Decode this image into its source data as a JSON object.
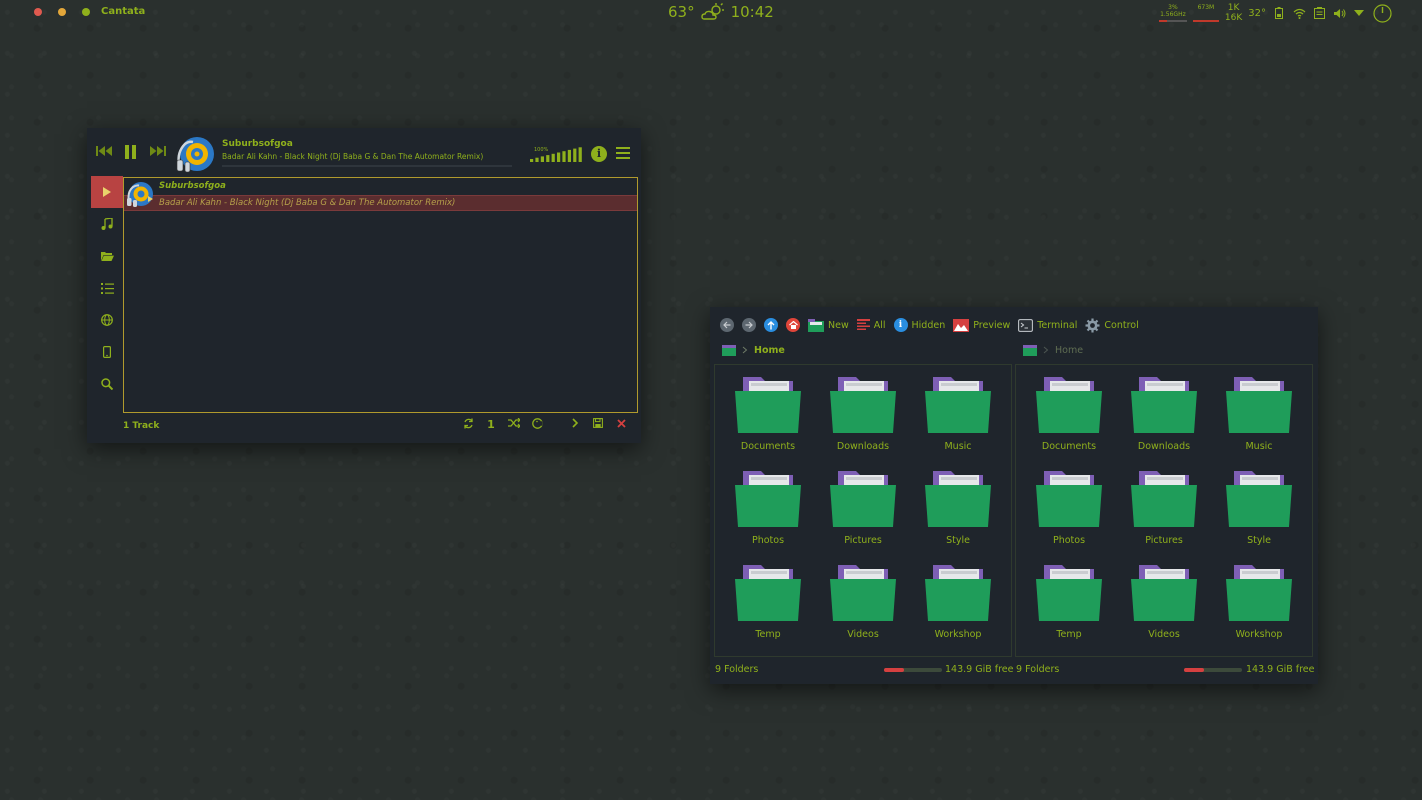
{
  "topbar": {
    "app_title": "Cantata",
    "temperature": "63°",
    "time": "10:42",
    "cpu_percent": "3%",
    "cpu_freq": "1.56GHz",
    "memory": "673M",
    "net_up": "1K",
    "net_down": "16K",
    "cpu_temp": "32°",
    "colors": {
      "close": "#e05a4f",
      "minimize": "#e3a73a",
      "maximize": "#8fb01c"
    }
  },
  "player": {
    "now_playing_artist": "Suburbsofgoa",
    "now_playing_title": "Badar Ali Kahn - Black Night (Dj Baba G & Dan The Automator Remix)",
    "volume_label": "100%",
    "volume": 1.0,
    "sidebar": [
      "play-queue-icon",
      "library-icon",
      "folders-icon",
      "playlists-icon",
      "internet-icon",
      "devices-icon",
      "search-icon"
    ],
    "playlist": {
      "artist": "Suburbsofgoa",
      "title": "Badar Ali Kahn - Black Night (Dj Baba G & Dan The Automator Remix)"
    },
    "status": "1 Track",
    "accent": "#8fb01c",
    "active_color": "#b84342"
  },
  "filemanager": {
    "toolbar": {
      "new": "New",
      "all": "All",
      "hidden": "Hidden",
      "preview": "Preview",
      "terminal": "Terminal",
      "control": "Control"
    },
    "left": {
      "breadcrumb": "Home",
      "folders": [
        "Documents",
        "Downloads",
        "Music",
        "Photos",
        "Pictures",
        "Style",
        "Temp",
        "Videos",
        "Workshop"
      ],
      "status": "9 Folders",
      "free": "143.9 GiB free",
      "disk_used": 0.35
    },
    "right": {
      "breadcrumb": "Home",
      "folders": [
        "Documents",
        "Downloads",
        "Music",
        "Photos",
        "Pictures",
        "Style",
        "Temp",
        "Videos",
        "Workshop"
      ],
      "status": "9 Folders",
      "free": "143.9 GiB free",
      "disk_used": 0.35
    },
    "folder_color": "#1f9d5a",
    "folder_tab_color": "#7e5fb5"
  }
}
